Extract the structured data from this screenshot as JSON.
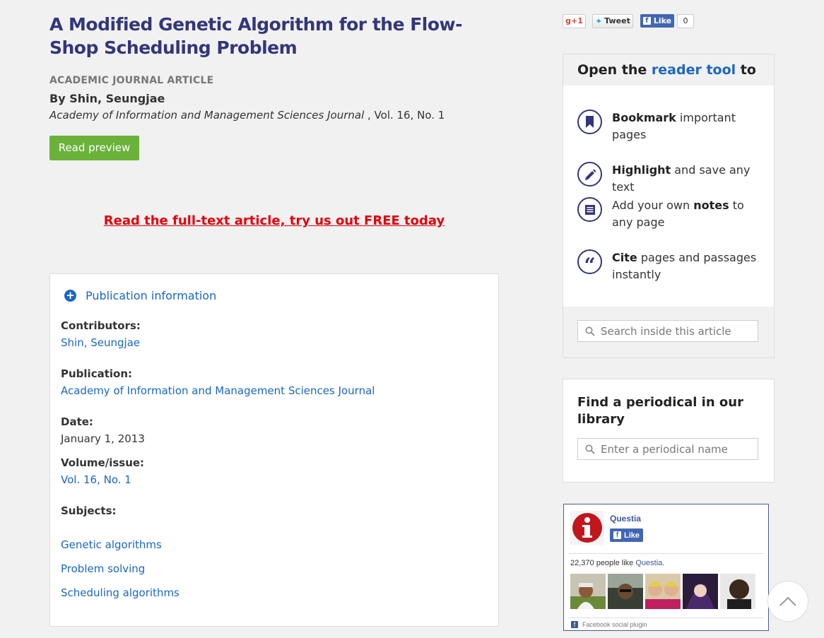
{
  "article": {
    "title": "A Modified Genetic Algorithm for the Flow-Shop Scheduling Problem",
    "doc_type": "Academic journal article",
    "byline": "By Shin, Seungjae",
    "journal": "Academy of Information and Management Sciences Journal",
    "volume_suffix": " , Vol. 16, No. 1",
    "read_preview_label": "Read preview",
    "cta_link": "Read the full-text article, try us out FREE today"
  },
  "publication_info": {
    "toggle_label": "Publication information",
    "contributors_label": "Contributors:",
    "contributors": "Shin, Seungjae",
    "publication_label": "Publication:",
    "publication": "Academy of Information and Management Sciences Journal",
    "date_label": "Date:",
    "date": "January 1, 2013",
    "volume_label": "Volume/issue:",
    "volume": "Vol. 16, No. 1",
    "subjects_label": "Subjects:",
    "subjects": [
      "Genetic algorithms",
      "Problem solving",
      "Scheduling algorithms"
    ]
  },
  "social": {
    "gplus": "g+1",
    "tweet": "Tweet",
    "fb_like": "Like",
    "fb_count": "0"
  },
  "reader_tool": {
    "title_prefix": "Open the ",
    "title_link": "reader tool",
    "title_suffix": " to",
    "features": [
      {
        "icon": "bookmark-icon",
        "bold": "Bookmark",
        "rest": " important pages"
      },
      {
        "icon": "highlight-pen-icon",
        "bold": "Highlight",
        "rest": " and save any text"
      },
      {
        "icon": "notes-icon",
        "pre": "Add your own ",
        "bold": "notes",
        "rest": " to any page"
      },
      {
        "icon": "quote-icon",
        "bold": "Cite",
        "rest": " pages and passages instantly"
      }
    ],
    "search_placeholder": "Search inside this article"
  },
  "periodical": {
    "title": "Find a periodical in our library",
    "search_placeholder": "Enter a periodical name"
  },
  "facebook_widget": {
    "page_name": "Questia",
    "like_label": "Like",
    "count_text": "22,370 people like ",
    "count_page": "Questia",
    "count_end": ".",
    "plugin_label": "Facebook social plugin"
  },
  "colors": {
    "title": "#33367a",
    "link": "#1a66c6",
    "button_green": "#6ab23a",
    "cta_red": "#e5000a",
    "facebook_blue": "#4267b2"
  }
}
